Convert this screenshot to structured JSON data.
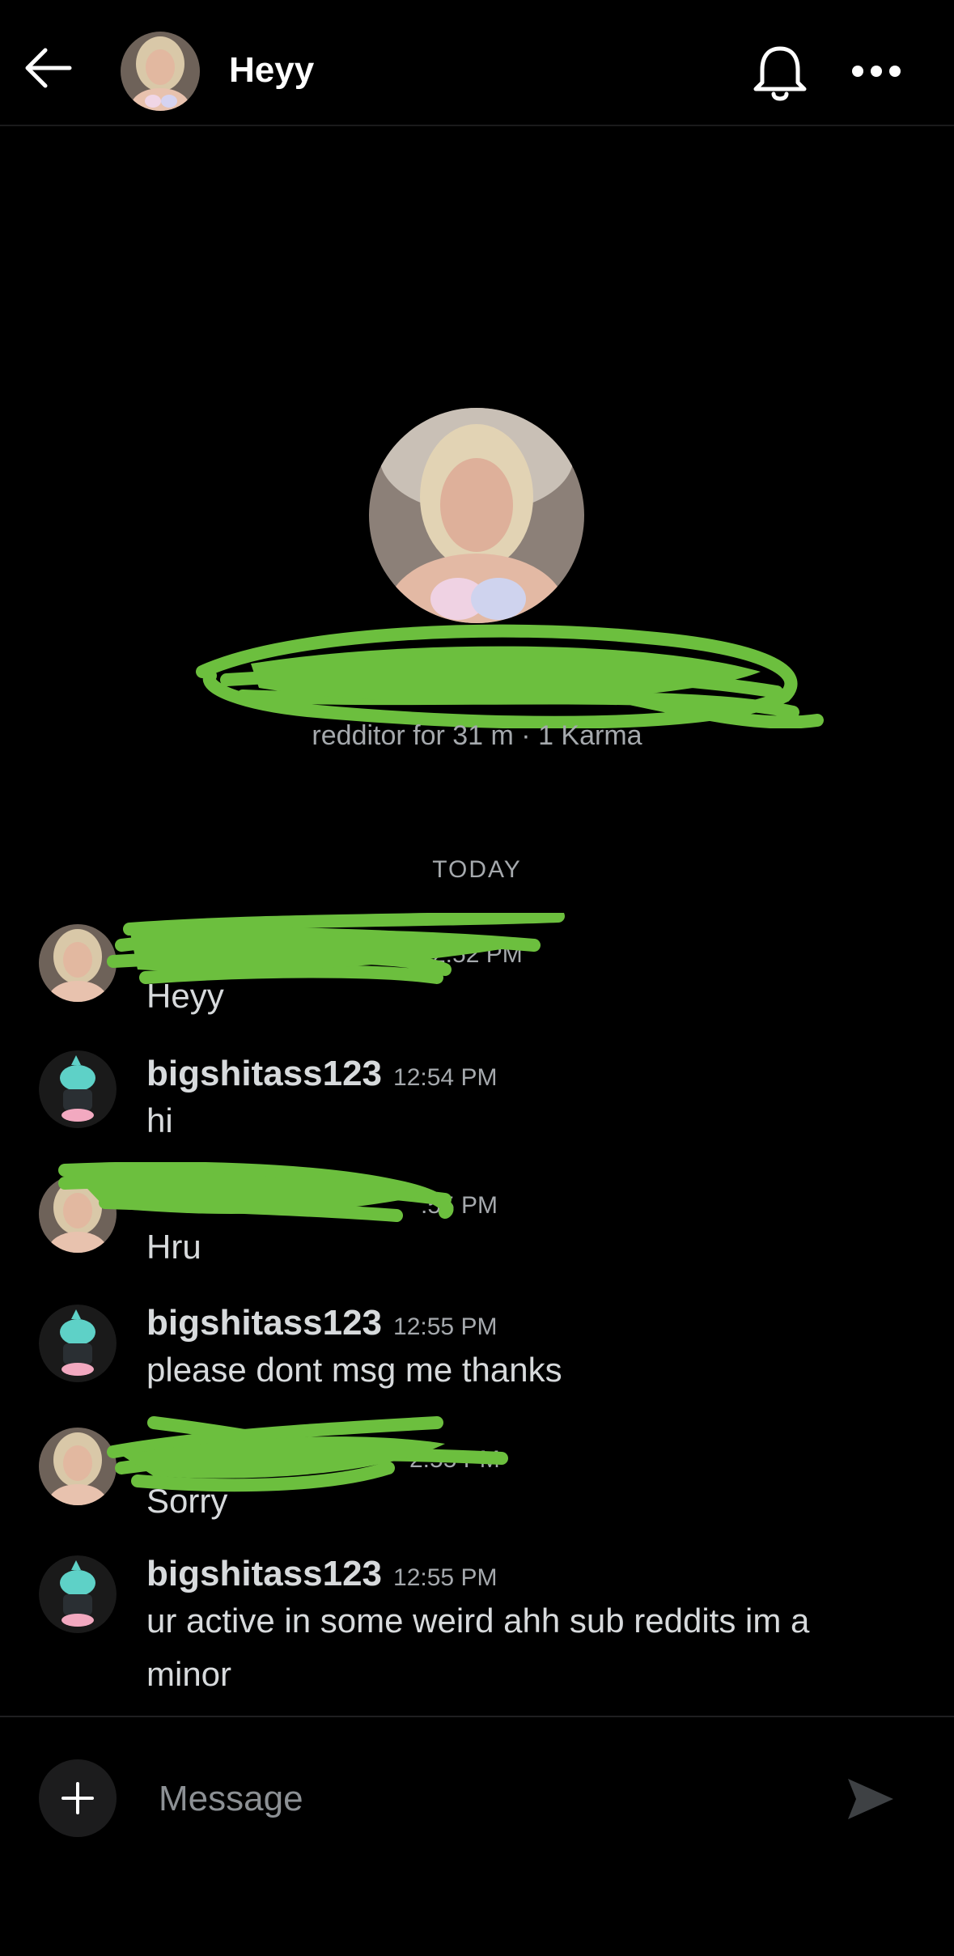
{
  "header": {
    "title": "Heyy"
  },
  "profile": {
    "meta": "redditor for 31 m · 1 Karma"
  },
  "conversation": {
    "day_label": "TODAY",
    "messages": [
      {
        "author": "",
        "time": "12:52 PM",
        "time_visible": "2:52 PM",
        "text": "Heyy"
      },
      {
        "author": "bigshitass123",
        "time": "12:54 PM",
        "text": "hi"
      },
      {
        "author": "",
        "time_visible": ":55 PM",
        "text": "Hru"
      },
      {
        "author": "bigshitass123",
        "time": "12:55 PM",
        "text": "please dont msg me thanks"
      },
      {
        "author": "",
        "time_visible": "2:55 PM",
        "text": "Sorry"
      },
      {
        "author": "bigshitass123",
        "time": "12:55 PM",
        "text": "ur active in some weird ahh sub reddits im a minor"
      }
    ]
  },
  "composer": {
    "placeholder": "Message"
  },
  "icons": {
    "back": "arrow-left-icon",
    "bell": "bell-icon",
    "more": "more-horizontal-icon",
    "add": "plus-icon",
    "send": "send-icon"
  },
  "colors": {
    "background": "#000000",
    "text": "#d7dadc",
    "meta_text": "#a5a9ad",
    "redaction_scribble": "#6cbf3e",
    "bot_avatar_accent": "#5ed1c7"
  }
}
